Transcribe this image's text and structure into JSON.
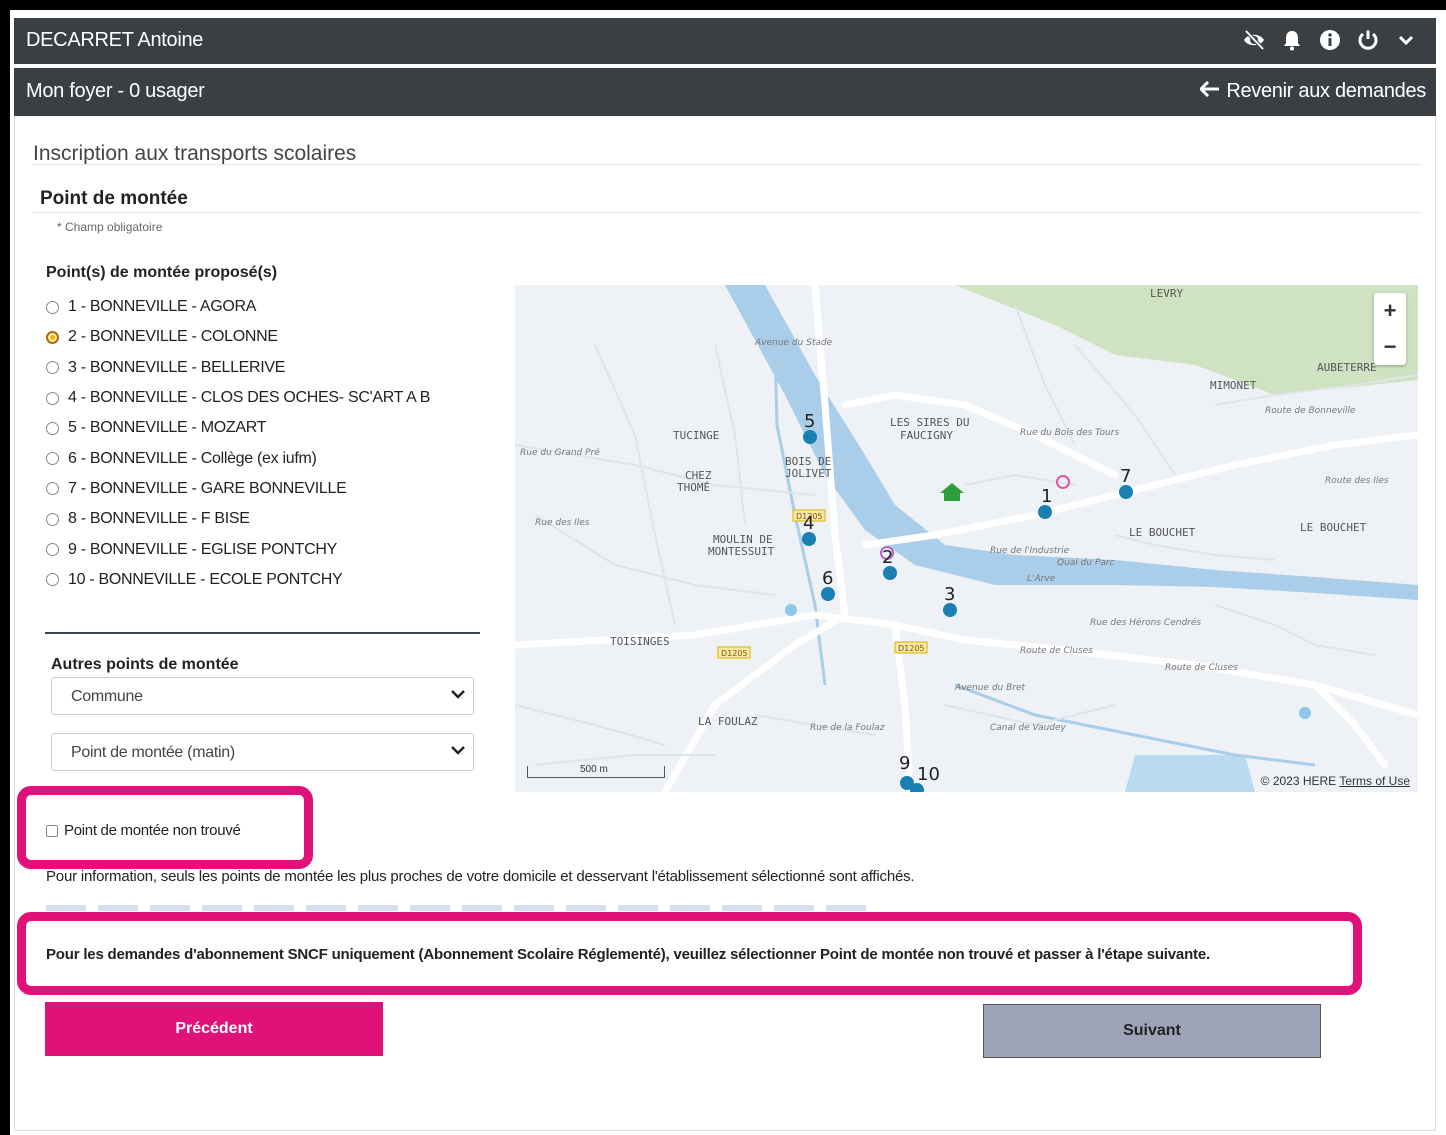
{
  "header": {
    "user_name": "DECARRET Antoine"
  },
  "subheader": {
    "foyer": "Mon foyer - 0 usager",
    "back_label": "Revenir aux demandes"
  },
  "page": {
    "title": "Inscription aux transports scolaires",
    "section_title": "Point de montée",
    "required_note": "* Champ obligatoire",
    "points_label": "Point(s) de montée proposé(s)"
  },
  "points": [
    {
      "label": "1 - BONNEVILLE - AGORA",
      "selected": false
    },
    {
      "label": "2 - BONNEVILLE - COLONNE",
      "selected": true
    },
    {
      "label": "3 - BONNEVILLE - BELLERIVE",
      "selected": false
    },
    {
      "label": "4 - BONNEVILLE - CLOS DES OCHES- SC'ART A B",
      "selected": false
    },
    {
      "label": "5 - BONNEVILLE - MOZART",
      "selected": false
    },
    {
      "label": "6 - BONNEVILLE - Collège (ex iufm)",
      "selected": false
    },
    {
      "label": "7 - BONNEVILLE - GARE BONNEVILLE",
      "selected": false
    },
    {
      "label": "8 - BONNEVILLE - F BISE",
      "selected": false
    },
    {
      "label": "9 - BONNEVILLE - EGLISE PONTCHY",
      "selected": false
    },
    {
      "label": "10 - BONNEVILLE - ECOLE PONTCHY",
      "selected": false
    }
  ],
  "others": {
    "label": "Autres points de montée",
    "commune_value": "Commune",
    "point_value": "Point de montée (matin)"
  },
  "not_found": {
    "label": "Point de montée non trouvé",
    "checked": false
  },
  "info_text": "Pour information, seuls les points de montée les plus proches de votre domicile et desservant l'établissement sélectionné sont affichés.",
  "sncf_text": "Pour les demandes d'abonnement SNCF uniquement (Abonnement Scolaire Réglementé), veuillez sélectionner Point de montée non trouvé et passer à l'étape suivante.",
  "buttons": {
    "prev": "Précédent",
    "next": "Suivant"
  },
  "map": {
    "attribution": "© 2023 HERE",
    "terms": "Terms of Use",
    "scale": "500 m",
    "zoom_in": "+",
    "zoom_out": "−",
    "markers": [
      "1",
      "2",
      "3",
      "4",
      "5",
      "6",
      "7",
      "9",
      "10"
    ],
    "places": [
      "LEVRY",
      "AUBETERRE",
      "MIMONET",
      "TUCINGE",
      "CHEZ",
      "THOMÉ",
      "BOIS DE",
      "JOLIVET",
      "LES SIRES DU",
      "FAUCIGNY",
      "LE BOUCHET",
      "LE BOUCHET",
      "MOULIN DE",
      "MONTESSUIT",
      "TOISINGES",
      "LA FOULAZ",
      "L'Arve",
      "Route de Cluses",
      "Route de Cluses",
      "Quai du Parc",
      "Rue de l'Industrie",
      "Avenue du Stade",
      "Rue des Iles",
      "Rue du Grand Pré",
      "Canal de Vaudey",
      "Avenue du Bret",
      "Rue de la Foulaz",
      "Rue des Hérons Cendrés",
      "Rue du Bois des Tours",
      "Route de Bonneville",
      "Route des Iles"
    ],
    "road_codes": [
      "D1205",
      "D1205",
      "D1205"
    ],
    "colors": {
      "water": "#aacdea",
      "green": "#cfe3c3",
      "road": "#ffffff",
      "marker": "#1a7fb3"
    }
  }
}
